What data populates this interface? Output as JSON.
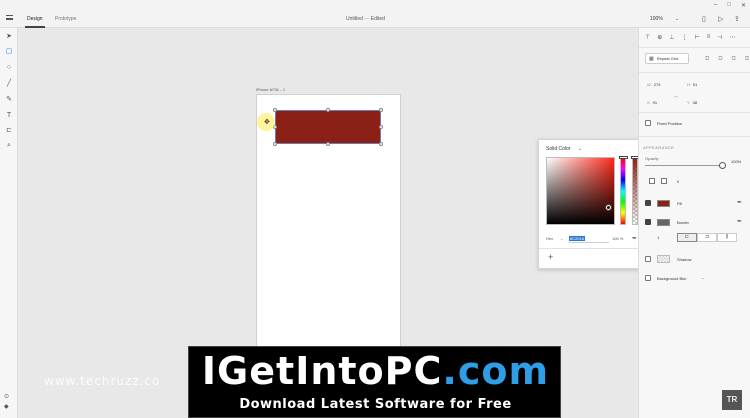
{
  "topbar": {
    "tabs": [
      {
        "label": "Design",
        "active": true
      },
      {
        "label": "Prototype",
        "active": false
      }
    ],
    "doc_title": "Untitled",
    "doc_sep": "—",
    "doc_status": "Edited",
    "zoom": "100%",
    "window_controls": [
      "minimize-icon",
      "maximize-icon",
      "close-icon"
    ]
  },
  "toolbar": {
    "tools": [
      "select-icon",
      "rectangle-icon",
      "ellipse-icon",
      "line-icon",
      "pen-icon",
      "text-icon",
      "artboard-icon",
      "zoom-icon"
    ],
    "active_tool": "rectangle-icon"
  },
  "canvas": {
    "artboard_label": "iPhone 6/7/8 – 1",
    "rect_fill": "#8b2017"
  },
  "color_picker": {
    "mode": "Solid Color",
    "hex_label": "Hex",
    "hex_value": "8C2016",
    "opacity": "100 %",
    "add_label": "+"
  },
  "panel": {
    "repeat_grid_label": "Repeat Grid",
    "dims": {
      "w_key": "W",
      "w": "274",
      "x_key": "X",
      "x": "91",
      "h_key": "H",
      "h": "51",
      "y_key": "Y",
      "y": "38"
    },
    "fixed_position_label": "Fixed Position",
    "appearance_heading": "APPEARANCE",
    "opacity_label": "Opacity",
    "opacity_value": "100%",
    "radius_value": "0",
    "fill_label": "Fill",
    "fill_color": "#8b2017",
    "border_label": "Border",
    "border_color": "#666666",
    "border_width": "1",
    "shadow_label": "Shadow",
    "background_blur_label": "Background Blur"
  },
  "watermark": {
    "title_part1": "IGetIntoPC",
    "title_part2": ".com",
    "subtitle": "Download Latest Software for Free",
    "site": "www.techruzz.co"
  },
  "corner_logo": "TR"
}
